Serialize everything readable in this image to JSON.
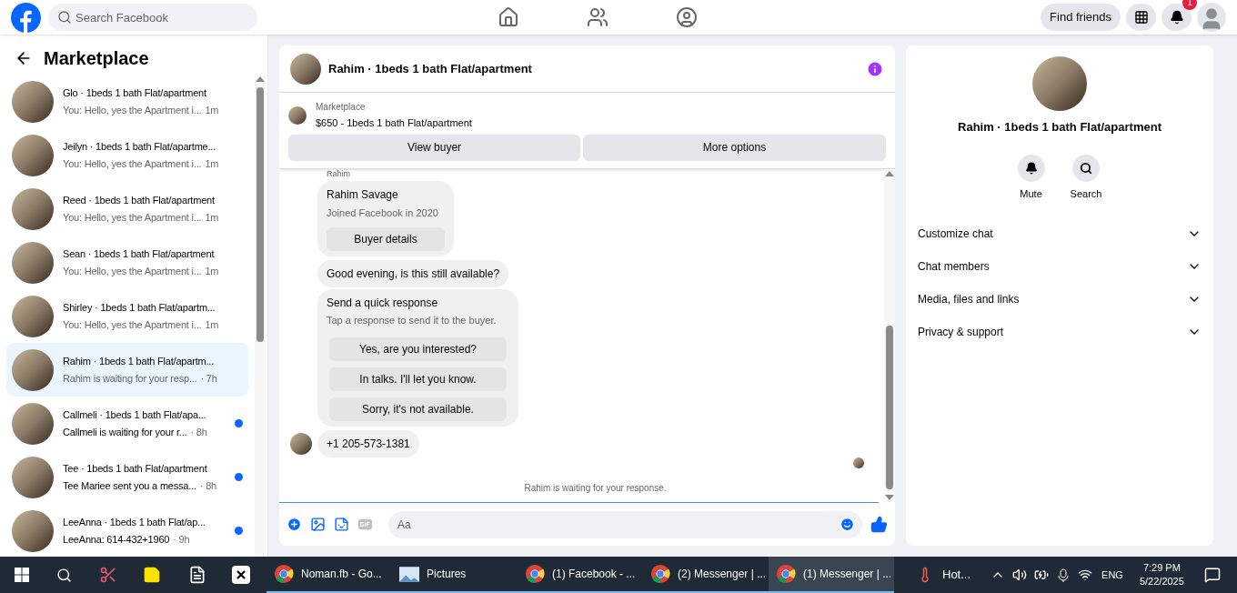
{
  "topbar": {
    "search": {
      "placeholder": "Search Facebook"
    },
    "nav": [
      {
        "kind": "home",
        "selected": false
      },
      {
        "kind": "friends",
        "selected": false
      },
      {
        "kind": "groups",
        "selected": false
      }
    ],
    "find_friends": "Find friends",
    "notification_count": "1"
  },
  "sidebar": {
    "title": "Marketplace",
    "conversations": [
      {
        "name": "Glo · 1beds 1 bath Flat/apartment",
        "preview": "You: Hello, yes the Apartment i...",
        "time": "1m",
        "unread": false,
        "selected": false
      },
      {
        "name": "Jeilyn · 1beds 1 bath Flat/apartme...",
        "preview": "You: Hello, yes the Apartment i...",
        "time": "1m",
        "unread": false,
        "selected": false
      },
      {
        "name": "Reed · 1beds 1 bath Flat/apartment",
        "preview": "You: Hello, yes the Apartment i...",
        "time": "1m",
        "unread": false,
        "selected": false
      },
      {
        "name": "Sean · 1beds 1 bath Flat/apartment",
        "preview": "You: Hello, yes the Apartment i...",
        "time": "1m",
        "unread": false,
        "selected": false
      },
      {
        "name": "Shirley · 1beds 1 bath Flat/apartm...",
        "preview": "You: Hello, yes the Apartment i...",
        "time": "1m",
        "unread": false,
        "selected": false
      },
      {
        "name": "Rahim · 1beds 1 bath Flat/apartm...",
        "preview": "Rahim is waiting for your resp...",
        "time": "· 7h",
        "unread": false,
        "selected": true
      },
      {
        "name": "Callmeli · 1beds 1 bath Flat/apa...",
        "preview": "Callmeli is waiting for your r...",
        "time": "· 8h",
        "unread": true,
        "selected": false
      },
      {
        "name": "Tee · 1beds 1 bath Flat/apartment",
        "preview": "Tee Mariee sent you a messa...",
        "time": "· 8h",
        "unread": true,
        "selected": false
      },
      {
        "name": "LeeAnna · 1beds 1 bath Flat/ap...",
        "preview": "LeeAnna: 614-432+1960",
        "time": "· 9h",
        "unread": true,
        "selected": false
      }
    ]
  },
  "chat": {
    "title": "Rahim · 1beds 1 bath Flat/apartment",
    "listing": {
      "label": "Marketplace",
      "title": "$650 - 1beds 1 bath Flat/apartment"
    },
    "actions": [
      "View buyer",
      "More options"
    ],
    "sender_label": "Rahim",
    "buyer_card": {
      "name": "Rahim Savage",
      "joined": "Joined Facebook in 2020",
      "button": "Buyer details"
    },
    "message": "Good evening, is this still available?",
    "quick_response": {
      "title": "Send a quick response",
      "subtitle": "Tap a response to send it to the buyer.",
      "options": [
        "Yes, are you interested?",
        "In talks. I'll let you know.",
        "Sorry, it's not available."
      ]
    },
    "phone_message": "+1 205-573-1381",
    "status": "Rahim is waiting for your response.",
    "composer": {
      "placeholder": "Aa"
    }
  },
  "details": {
    "title": "Rahim · 1beds 1 bath Flat/apartment",
    "actions": [
      {
        "kind": "mute",
        "label": "Mute"
      },
      {
        "kind": "search",
        "label": "Search"
      }
    ],
    "sections": [
      "Customize chat",
      "Chat members",
      "Media, files and links",
      "Privacy & support"
    ]
  },
  "taskbar": {
    "tasks": [
      {
        "label": "Noman.fb - Go...",
        "kind": "chrome",
        "selected": false
      },
      {
        "label": "Pictures",
        "kind": "pictures",
        "selected": false
      },
      {
        "label": "(1) Facebook - ...",
        "kind": "chrome",
        "selected": false
      },
      {
        "label": "(2) Messenger | ...",
        "kind": "chrome",
        "selected": false
      },
      {
        "label": "(1) Messenger | ...",
        "kind": "chrome",
        "selected": true
      }
    ],
    "weather": "Hot...",
    "language": "ENG",
    "time": "7:29 PM",
    "date": "5/22/2025"
  }
}
